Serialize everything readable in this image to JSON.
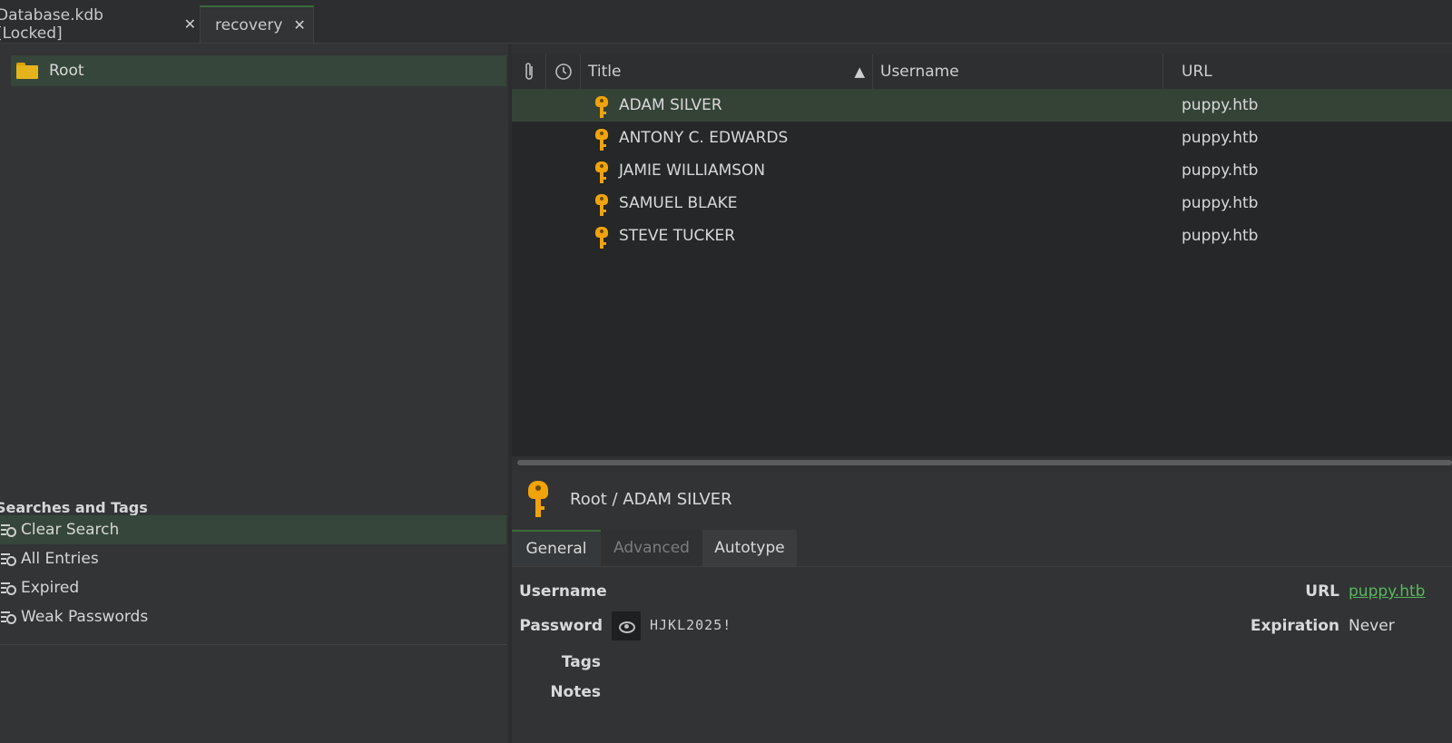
{
  "tabs": [
    {
      "label": "Database.kdb [Locked]",
      "close": "✕"
    },
    {
      "label": "recovery",
      "close": "✕"
    }
  ],
  "sidebar": {
    "root_label": "Root",
    "searches_header": "Searches and Tags",
    "searches": [
      "Clear Search",
      "All Entries",
      "Expired",
      "Weak Passwords"
    ]
  },
  "table": {
    "columns": {
      "title": "Title",
      "sort_indicator": "▲",
      "username": "Username",
      "url": "URL"
    },
    "rows": [
      {
        "title": "ADAM SILVER",
        "username": "",
        "url": "puppy.htb"
      },
      {
        "title": "ANTONY C. EDWARDS",
        "username": "",
        "url": "puppy.htb"
      },
      {
        "title": "JAMIE WILLIAMSON",
        "username": "",
        "url": "puppy.htb"
      },
      {
        "title": "SAMUEL BLAKE",
        "username": "",
        "url": "puppy.htb"
      },
      {
        "title": "STEVE TUCKER",
        "username": "",
        "url": "puppy.htb"
      }
    ]
  },
  "preview": {
    "breadcrumb": "Root / ADAM SILVER",
    "tabs": [
      "General",
      "Advanced",
      "Autotype"
    ],
    "fields": {
      "username_label": "Username",
      "password_label": "Password",
      "password_value": "HJKL2025!",
      "tags_label": "Tags",
      "notes_label": "Notes",
      "url_label": "URL",
      "url_value": "puppy.htb",
      "expiration_label": "Expiration",
      "expiration_value": "Never"
    }
  },
  "colors": {
    "accent": "#3b6a3a",
    "selection": "#354337",
    "key_icon": "#f0a30a",
    "link": "#58b85c"
  }
}
